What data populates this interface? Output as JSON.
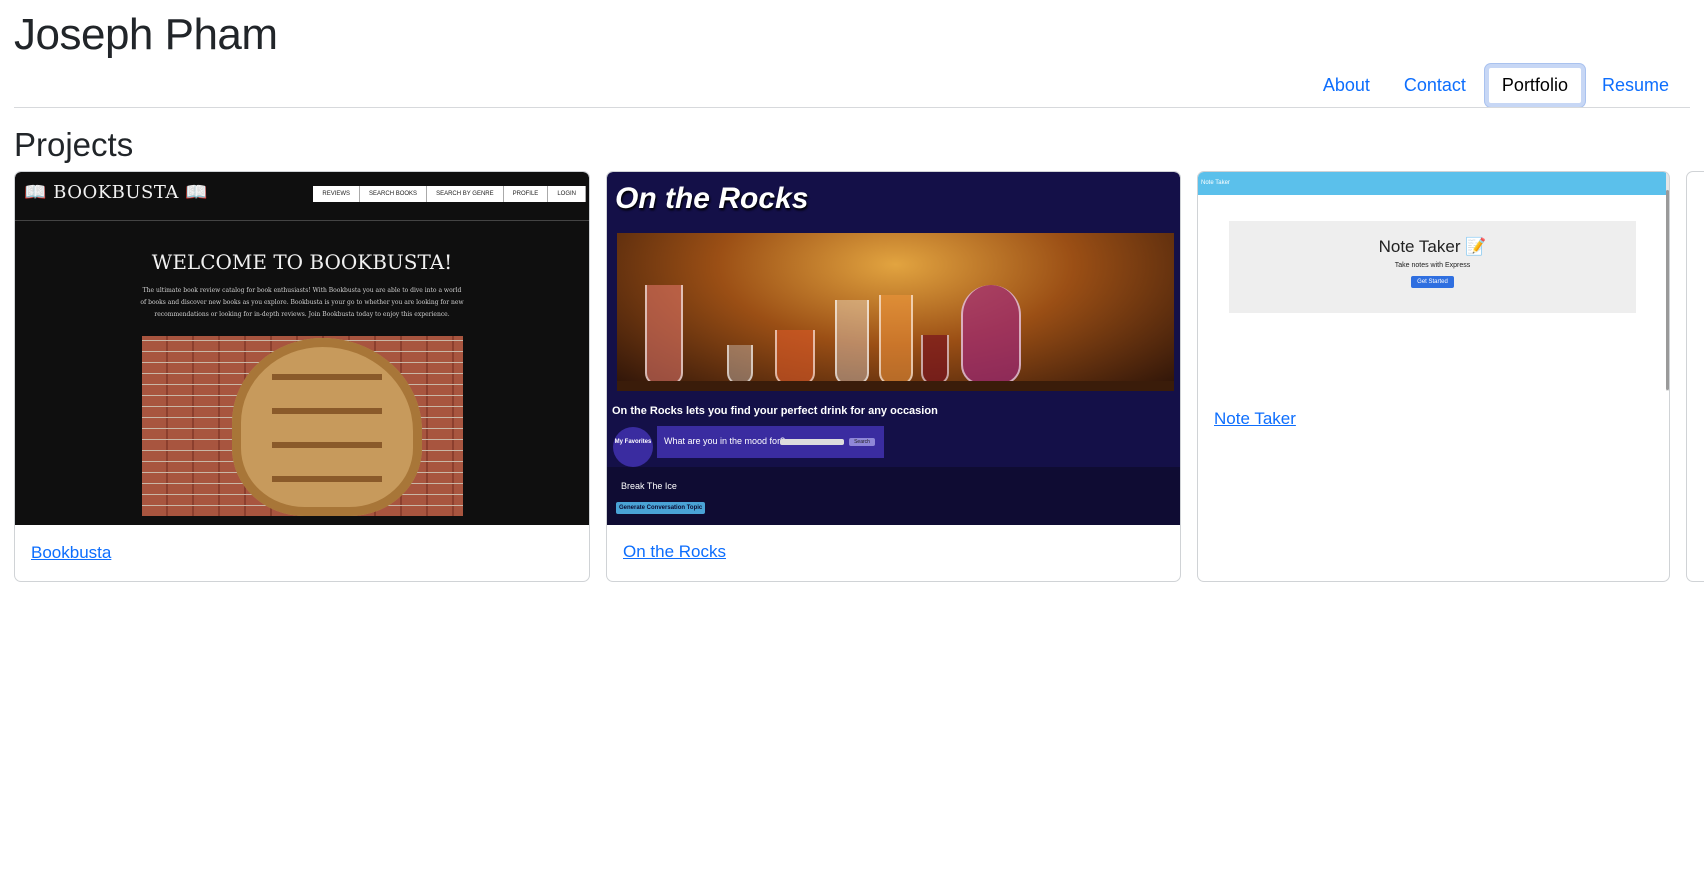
{
  "header": {
    "site_title": "Joseph Pham",
    "nav": [
      {
        "label": "About",
        "active": false
      },
      {
        "label": "Contact",
        "active": false
      },
      {
        "label": "Portfolio",
        "active": true
      },
      {
        "label": "Resume",
        "active": false
      }
    ]
  },
  "main": {
    "section_title": "Projects",
    "projects": [
      {
        "link_label": "Bookbusta",
        "thumbnail": {
          "brand": "📖 BOOKBUSTA 📖",
          "nav": [
            "REVIEWS",
            "SEARCH BOOKS",
            "SEARCH BY GENRE",
            "PROFILE",
            "LOGIN"
          ],
          "heading": "WELCOME TO BOOKBUSTA!",
          "description": "The ultimate book review catalog for book enthusiasts! With Bookbusta you are able to dive into a world of books and discover new books as you explore. Bookbusta is your go to whether you are looking for new recommendations or looking for in-depth reviews. Join Bookbusta today to enjoy this experience."
        }
      },
      {
        "link_label": "On the Rocks",
        "thumbnail": {
          "title": "On the Rocks",
          "tagline": "On the Rocks lets you find your perfect drink for any occasion",
          "favorites": "My Favorites",
          "search_prompt": "What are you in the mood for?",
          "search_button": "Search",
          "ice_label": "Break The Ice",
          "generate_button": "Generate Conversation Topic"
        }
      },
      {
        "link_label": "Note Taker",
        "thumbnail": {
          "navbar_title": "Note Taker",
          "heading": "Note Taker 📝",
          "subheading": "Take notes with Express",
          "button": "Get Started"
        }
      }
    ]
  }
}
